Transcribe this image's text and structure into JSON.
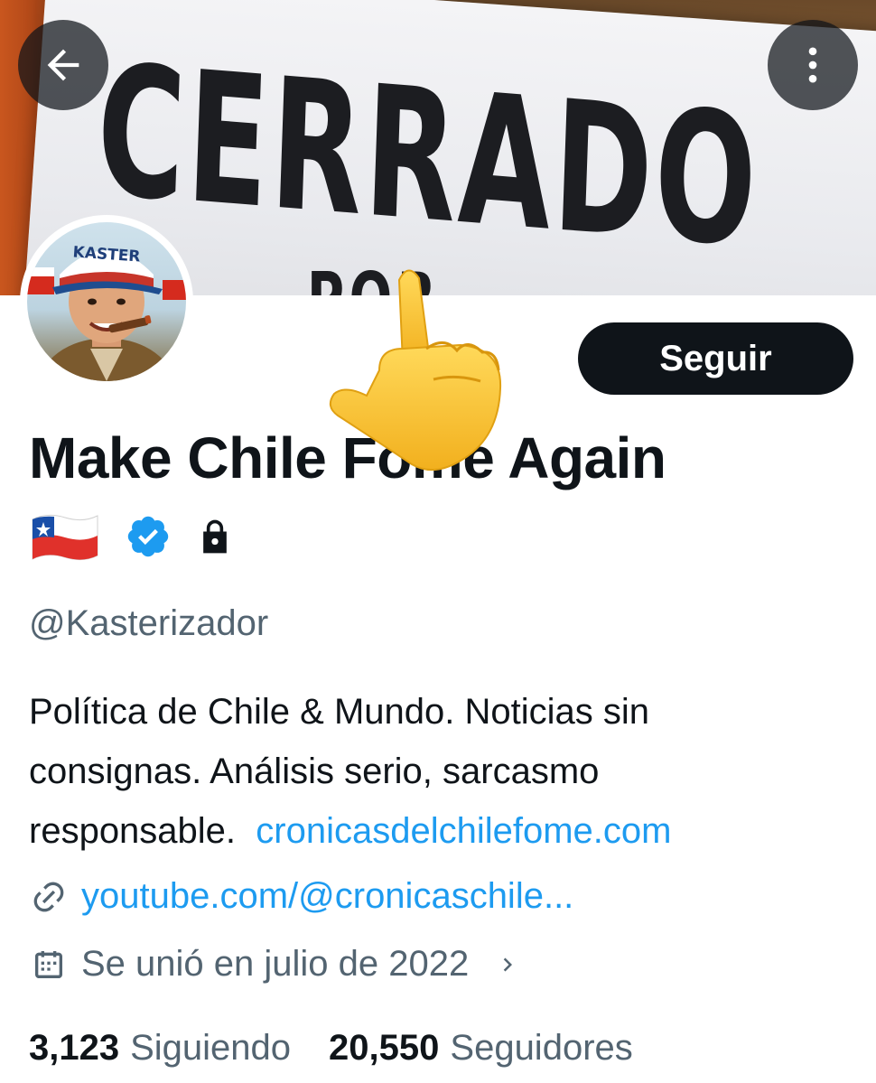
{
  "banner": {
    "sign_word": "CERRADO",
    "sign_sub": "POR"
  },
  "toolbar": {
    "back_icon": "arrow-left-icon",
    "more_icon": "more-vertical-icon"
  },
  "profile": {
    "avatar_cap_text": "KASTER",
    "follow_label": "Seguir",
    "display_name": "Make Chile Fome Again",
    "badges": [
      "chile-flag-icon",
      "verified-badge-icon",
      "lock-icon"
    ],
    "handle": "@Kasterizador",
    "bio_line1": "Política de Chile & Mundo. Noticias sin",
    "bio_line2": "consignas. Análisis serio, sarcasmo",
    "bio_line3_text": "responsable.",
    "bio_line3_link": "cronicasdelchilefome.com",
    "website": "youtube.com/@cronicaschile...",
    "joined": "Se unió en julio de 2022",
    "following_count": "3,123",
    "following_label": "Siguiendo",
    "followers_count": "20,550",
    "followers_label": "Seguidores"
  },
  "colors": {
    "accent": "#1d9bf0",
    "text_primary": "#0f1419",
    "text_secondary": "#536471",
    "button_bg": "#0f1419"
  }
}
